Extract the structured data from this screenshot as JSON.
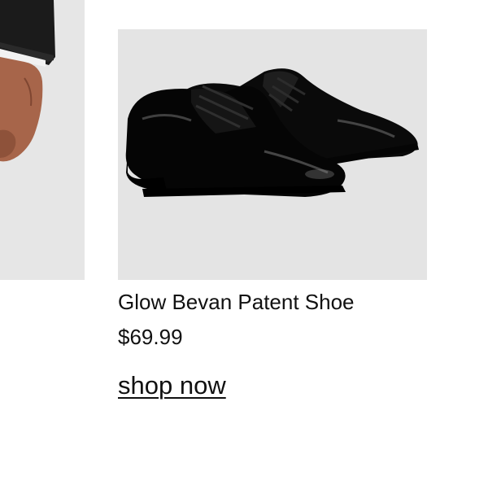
{
  "product": {
    "name": "Glow Bevan Patent Shoe",
    "price": "$69.99",
    "cta_label": "shop now",
    "image_icon": "patent-oxford-shoe",
    "image_background": "#e4e4e4"
  },
  "adjacent_product": {
    "image_icon": "suit-sleeve-hand",
    "image_background": "#e6e6e6"
  },
  "colors": {
    "text": "#111111",
    "background": "#ffffff"
  }
}
